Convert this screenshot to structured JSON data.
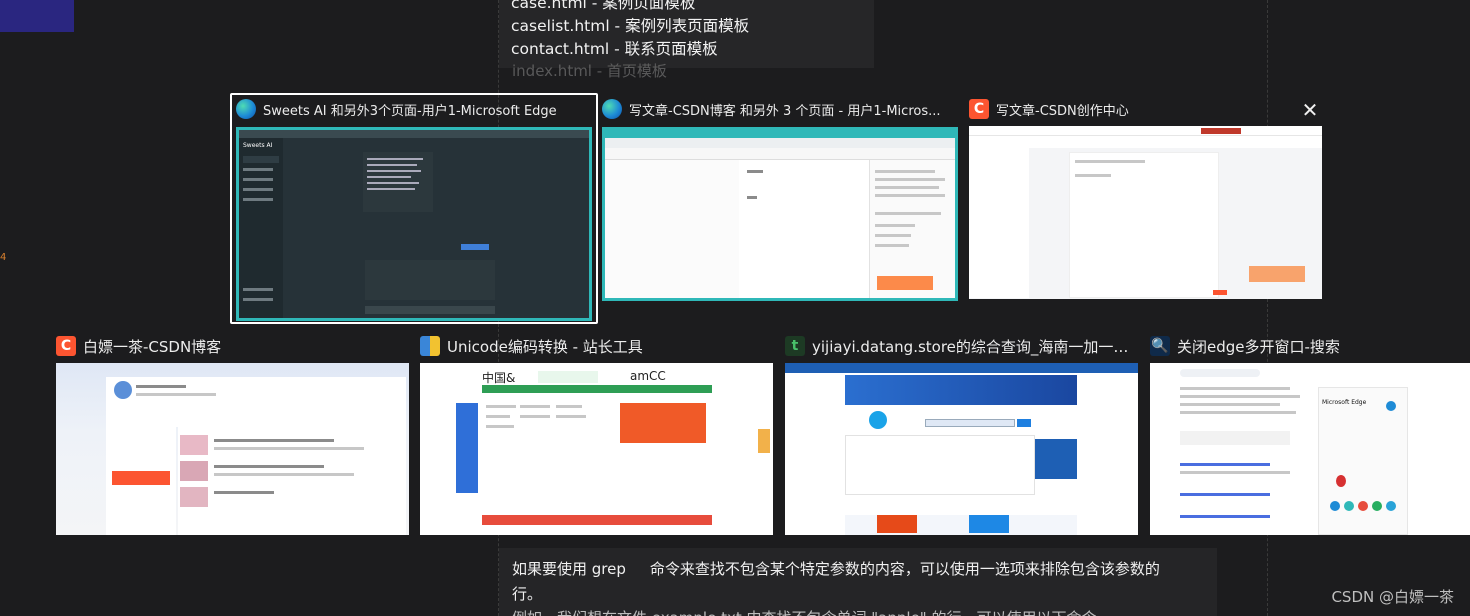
{
  "background": {
    "code_lines": [
      "case.html - 案例页面模板",
      "caselist.html - 案例列表页面模板",
      "contact.html - 联系页面模板",
      "index.html - 首页模板"
    ],
    "paragraph_line1_a": "如果要使用 grep",
    "paragraph_line1_b": "命令来查找不包含某个特定参数的内容，可以使用一选项来排除包含该参数的",
    "paragraph_line2": "行。",
    "paragraph_line3": "例如，我们想在文件 example.txt 中查找不包含单词 \"apple\" 的行，可以使用以下命令",
    "watermark": "CSDN @白嫖一茶"
  },
  "windows": [
    {
      "title": "Sweets AI 和另外3个页面-用户1-Microsoft Edge",
      "icon": "edge-icon",
      "selected": true
    },
    {
      "title": "写文章-CSDN博客 和另外 3 个页面 - 用户1-Micros...",
      "icon": "edge-icon",
      "selected": false
    },
    {
      "title": "写文章-CSDN创作中心",
      "icon": "csdn-icon",
      "selected": false
    },
    {
      "title": "白嫖一茶-CSDN博客",
      "icon": "csdn-icon",
      "selected": false
    },
    {
      "title": "Unicode编码转换 - 站长工具",
      "icon": "tool-icon",
      "selected": false
    },
    {
      "title": "yijiayi.datang.store的综合查询_海南一加一工程担保…",
      "icon": "site-icon",
      "selected": false
    },
    {
      "title": "关闭edge多开窗口-搜索",
      "icon": "search-icon",
      "selected": false
    }
  ],
  "thumb_text": {
    "sweets_brand": "Sweets AI",
    "unicode_heading": "中国&",
    "unicode_heading2": "amCC",
    "bing_panel": "Microsoft Edge"
  },
  "colors": {
    "edge_teal": "#2fb8b8",
    "csdn_red": "#fc5531",
    "selection": "#ffffff"
  }
}
